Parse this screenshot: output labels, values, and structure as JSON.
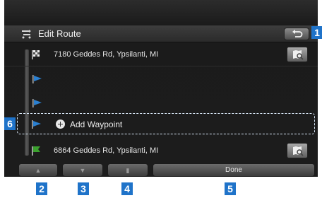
{
  "header": {
    "title": "Edit Route"
  },
  "route": {
    "start_address": "7180 Geddes Rd, Ypsilanti, MI",
    "end_address": "6864 Geddes Rd, Ypsilanti, MI",
    "add_waypoint_label": "Add Waypoint"
  },
  "toolbar": {
    "done_label": "Done"
  },
  "callouts": [
    "1",
    "2",
    "3",
    "4",
    "5",
    "6"
  ],
  "colors": {
    "callout": "#1f73c9",
    "start_flag": "#bcbcbc",
    "waypoint_flag": "#2a7fd0",
    "end_flag": "#3ba12e"
  }
}
